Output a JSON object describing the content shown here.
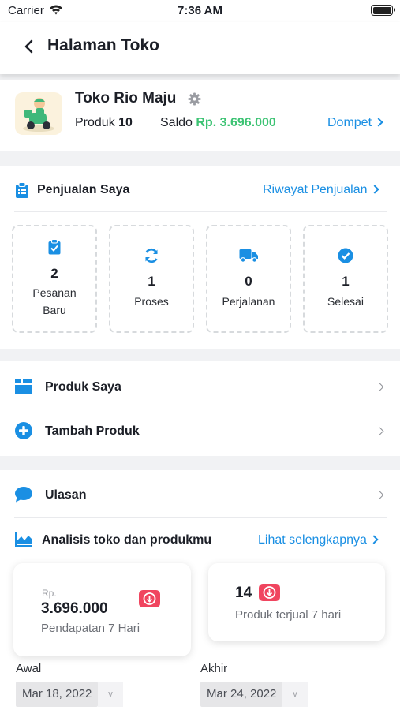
{
  "status_bar": {
    "carrier": "Carrier",
    "time": "7:36 AM"
  },
  "header": {
    "title": "Halaman Toko"
  },
  "store": {
    "name": "Toko Rio Maju",
    "product_label": "Produk",
    "product_count": "10",
    "saldo_label": "Saldo",
    "saldo_amount": "Rp. 3.696.000",
    "wallet_link": "Dompet"
  },
  "sales": {
    "title": "Penjualan Saya",
    "history_link": "Riwayat Penjualan",
    "boxes": [
      {
        "count": "2",
        "label_line1": "Pesanan",
        "label_line2": "Baru",
        "icon": "clipboard-check-icon"
      },
      {
        "count": "1",
        "label_line1": "Proses",
        "icon": "sync-icon"
      },
      {
        "count": "0",
        "label_line1": "Perjalanan",
        "icon": "truck-icon"
      },
      {
        "count": "1",
        "label_line1": "Selesai",
        "icon": "check-circle-icon"
      }
    ]
  },
  "menu": {
    "my_products": "Produk Saya",
    "add_product": "Tambah Produk",
    "reviews": "Ulasan"
  },
  "analysis": {
    "title": "Analisis toko dan produkmu",
    "more_link": "Lihat selengkapnya",
    "revenue_currency": "Rp.",
    "revenue_amount": "3.696.000",
    "revenue_label": "Pendapatan 7 Hari",
    "sold_count": "14",
    "sold_label": "Produk terjual 7 hari",
    "start_label": "Awal",
    "start_date": "Mar 18, 2022",
    "end_label": "Akhir",
    "end_date": "Mar 24, 2022",
    "dropdown_glyph": "v"
  },
  "colors": {
    "accent": "#1a8fe3",
    "money": "#3cc373",
    "down_badge": "#f0455f"
  }
}
